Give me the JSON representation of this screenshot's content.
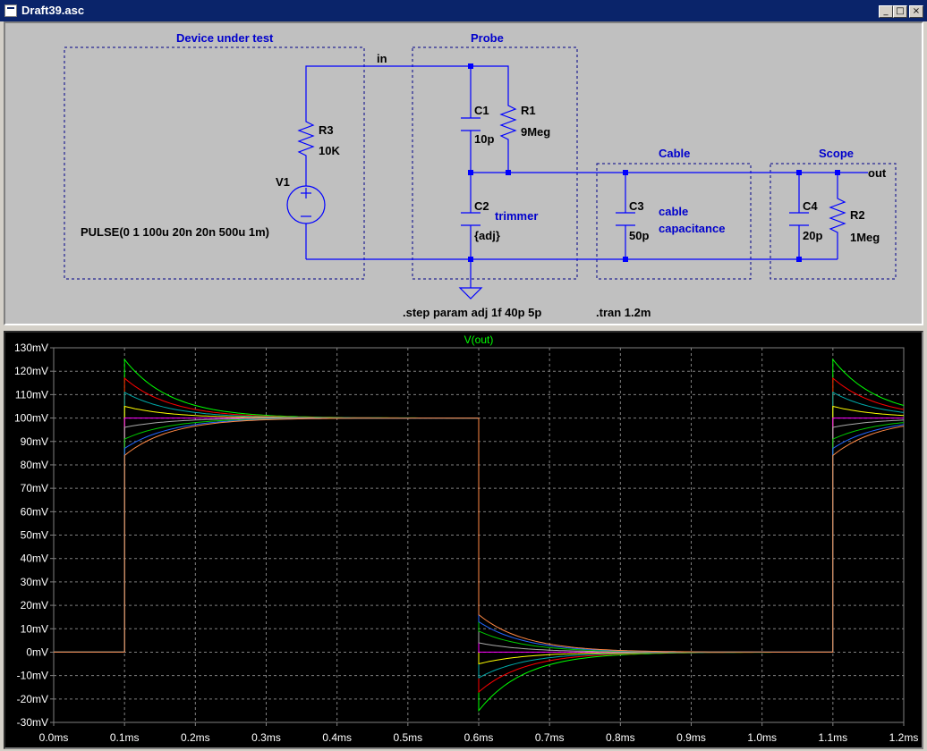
{
  "window": {
    "title": "Draft39.asc",
    "minimize_label": "_",
    "maximize_label": "□",
    "close_label": "×"
  },
  "schematic": {
    "boxes": {
      "dut": "Device under test",
      "probe": "Probe",
      "cable": "Cable",
      "scope": "Scope"
    },
    "nets": {
      "in": "in",
      "out": "out"
    },
    "components": {
      "r3": {
        "name": "R3",
        "value": "10K"
      },
      "v1": {
        "name": "V1",
        "value": "PULSE(0 1 100u 20n 20n 500u 1m)"
      },
      "c1": {
        "name": "C1",
        "value": "10p"
      },
      "r1": {
        "name": "R1",
        "value": "9Meg"
      },
      "c2": {
        "name": "C2",
        "value": "{adj}",
        "comment": "trimmer"
      },
      "c3": {
        "name": "C3",
        "value": "50p",
        "comment1": "cable",
        "comment2": "capacitance"
      },
      "c4": {
        "name": "C4",
        "value": "20p"
      },
      "r2": {
        "name": "R2",
        "value": "1Meg"
      }
    },
    "directives": {
      "step": ".step param adj 1f 40p 5p",
      "tran": ".tran 1.2m"
    },
    "colors": {
      "wire": "#0000ff",
      "text_comment": "#0000cc",
      "label": "#000000"
    }
  },
  "chart_data": {
    "type": "line",
    "title": "V(out)",
    "xlabel": "",
    "ylabel": "",
    "xlim": [
      0,
      1.2
    ],
    "ylim": [
      -30,
      130
    ],
    "x_unit": "ms",
    "y_unit": "mV",
    "x_ticks": [
      "0.0ms",
      "0.1ms",
      "0.2ms",
      "0.3ms",
      "0.4ms",
      "0.5ms",
      "0.6ms",
      "0.7ms",
      "0.8ms",
      "0.9ms",
      "1.0ms",
      "1.1ms",
      "1.2ms"
    ],
    "y_ticks": [
      "130mV",
      "120mV",
      "110mV",
      "100mV",
      "90mV",
      "80mV",
      "70mV",
      "60mV",
      "50mV",
      "40mV",
      "30mV",
      "20mV",
      "10mV",
      "0mV",
      "-10mV",
      "-20mV",
      "-30mV"
    ],
    "grid": true,
    "rise_times": [
      0.1,
      1.1
    ],
    "fall_time": 0.6,
    "steady_high": 100,
    "steady_low": 0,
    "series": [
      {
        "color": "#00ff00",
        "overshoot": 25
      },
      {
        "color": "#ff0000",
        "overshoot": 17
      },
      {
        "color": "#00aaaa",
        "overshoot": 11
      },
      {
        "color": "#ffff00",
        "overshoot": 5
      },
      {
        "color": "#ff00ff",
        "overshoot": 0
      },
      {
        "color": "#aaaaaa",
        "overshoot": -4
      },
      {
        "color": "#00cc00",
        "overshoot": -9
      },
      {
        "color": "#2266ff",
        "overshoot": -13
      },
      {
        "color": "#ff8844",
        "overshoot": -16
      }
    ]
  }
}
